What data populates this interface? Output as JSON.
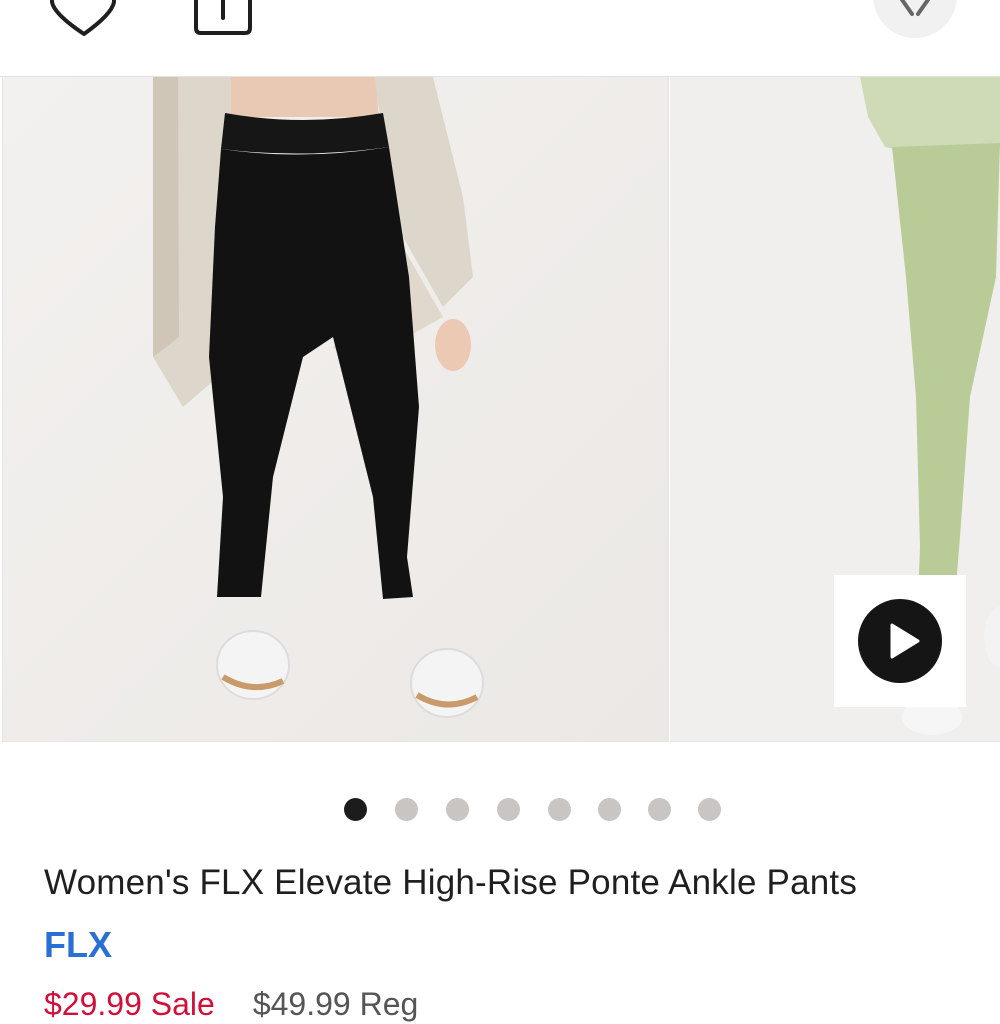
{
  "header": {
    "wishlist_icon": "heart-outline-icon",
    "share_icon": "share-icon",
    "close_icon": "close-icon"
  },
  "gallery": {
    "slides": [
      {
        "description": "black leggings product photo",
        "icon": "image"
      },
      {
        "description": "green leggings product photo",
        "icon": "image"
      }
    ],
    "video_button_icon": "play-icon",
    "dot_count": 8,
    "active_dot": 0
  },
  "product": {
    "title": "Women's FLX Elevate High-Rise Ponte Ankle Pants",
    "brand": "FLX",
    "sale_price": "$29.99 Sale",
    "regular_price": "$49.99 Reg",
    "colors": {
      "brand_link": "#2a6fd6",
      "sale": "#d0103a",
      "dot_active": "#1c1c1c",
      "dot_inactive": "#c8c5c2"
    }
  }
}
